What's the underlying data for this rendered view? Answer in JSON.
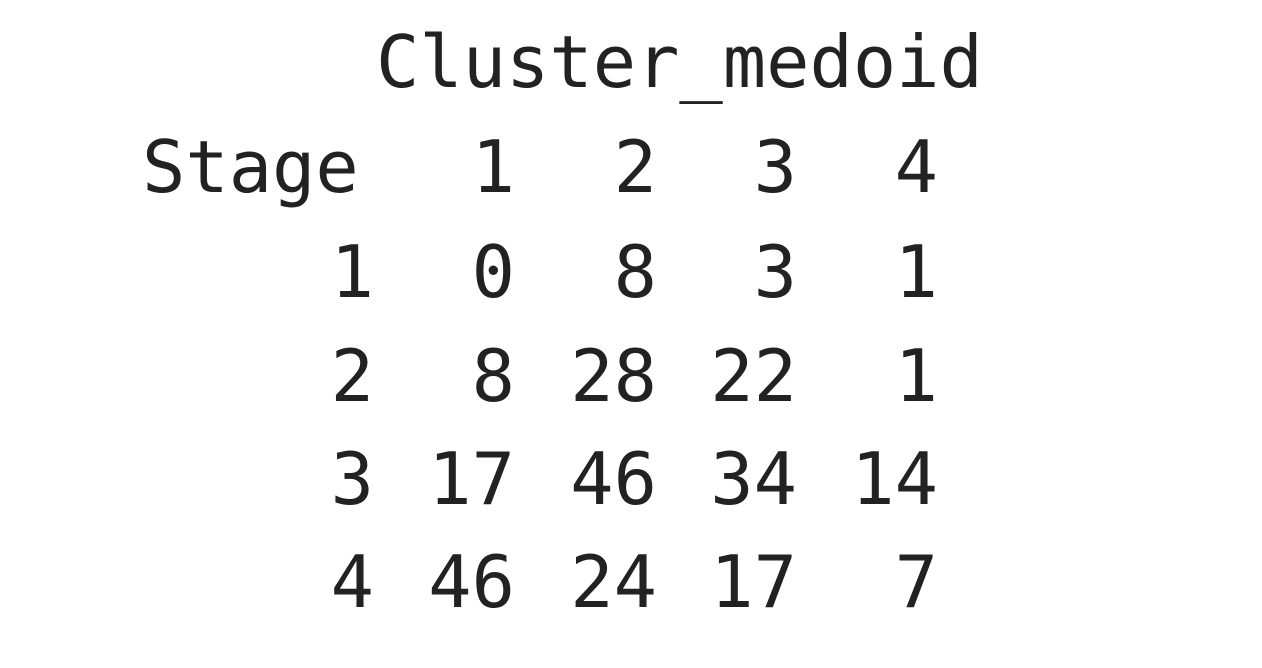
{
  "table": {
    "column_variable": "Cluster_medoid",
    "row_variable": "Stage",
    "column_headers": [
      "1",
      "2",
      "3",
      "4"
    ],
    "rows": [
      {
        "label": "1",
        "values": [
          "0",
          "8",
          "3",
          "1"
        ]
      },
      {
        "label": "2",
        "values": [
          "8",
          "28",
          "22",
          "1"
        ]
      },
      {
        "label": "3",
        "values": [
          "17",
          "46",
          "34",
          "14"
        ]
      },
      {
        "label": "4",
        "values": [
          "46",
          "24",
          "17",
          "7"
        ]
      }
    ]
  }
}
